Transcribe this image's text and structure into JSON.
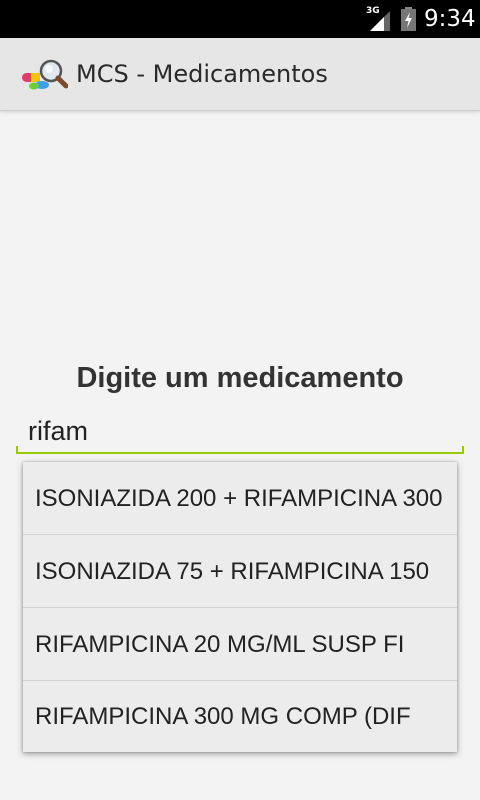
{
  "status_bar": {
    "network_label": "3G",
    "time": "9:34"
  },
  "action_bar": {
    "title": "MCS - Medicamentos"
  },
  "main": {
    "prompt": "Digite um medicamento",
    "search_value": "rifam",
    "suggestions": [
      "ISONIAZIDA 200 + RIFAMPICINA 300",
      "ISONIAZIDA 75 + RIFAMPICINA 150",
      "RIFAMPICINA 20 MG/ML SUSP FI",
      "RIFAMPICINA 300 MG COMP (DIF"
    ]
  },
  "colors": {
    "accent_underline": "#99cc00",
    "action_bar_bg": "#e6e6e6",
    "page_bg": "#f3f3f3"
  }
}
